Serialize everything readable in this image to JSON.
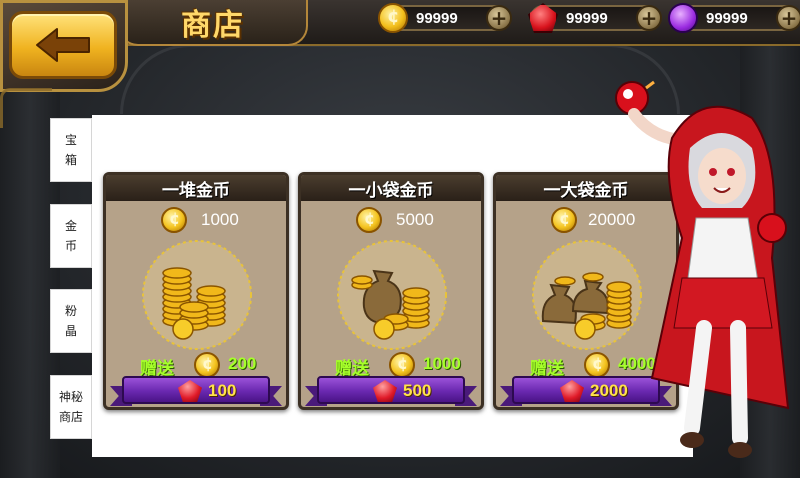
{
  "header": {
    "title": "商店",
    "back_icon": "left-arrow-icon"
  },
  "currencies": [
    {
      "icon": "gold-coin-icon",
      "value": "99999",
      "add_icon": "plus-icon"
    },
    {
      "icon": "ruby-gem-icon",
      "value": "99999",
      "add_icon": "plus-icon"
    },
    {
      "icon": "purple-crystal-icon",
      "value": "99999",
      "add_icon": "plus-icon"
    }
  ],
  "sidebar": {
    "tabs": [
      {
        "line1": "宝",
        "line2": "箱"
      },
      {
        "line1": "金",
        "line2": "币"
      },
      {
        "line1": "粉",
        "line2": "晶"
      },
      {
        "line1": "神秘",
        "line2": "商店"
      }
    ]
  },
  "shop": {
    "items": [
      {
        "title": "一堆金币",
        "amount": "1000",
        "bonus_label": "赠送",
        "bonus": "200",
        "price": "100"
      },
      {
        "title": "一小袋金币",
        "amount": "5000",
        "bonus_label": "赠送",
        "bonus": "1000",
        "price": "500"
      },
      {
        "title": "一大袋金币",
        "amount": "20000",
        "bonus_label": "赠送",
        "bonus": "4000",
        "price": "2000"
      }
    ]
  },
  "colors": {
    "gold": "#f3bf1c",
    "bonus_green": "#a6ff2a",
    "price_yellow": "#ffe24a",
    "ribbon_purple": "#6a28b0",
    "card_bg": "#b5a289"
  }
}
